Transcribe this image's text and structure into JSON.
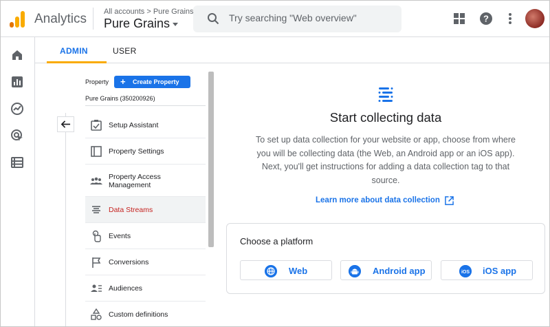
{
  "header": {
    "app_name": "Analytics",
    "breadcrumb": "All accounts > Pure Grains",
    "account_name": "Pure Grains",
    "search_placeholder": "Try searching \"Web overview\""
  },
  "tabs": {
    "admin": "ADMIN",
    "user": "USER"
  },
  "property": {
    "label": "Property",
    "create_button": "Create Property",
    "name": "Pure Grains (350200926)",
    "menu": [
      {
        "label": "Setup Assistant",
        "icon": "checklist-icon"
      },
      {
        "label": "Property Settings",
        "icon": "settings-panel-icon"
      },
      {
        "label": "Property Access Management",
        "icon": "people-icon"
      },
      {
        "label": "Data Streams",
        "icon": "streams-icon",
        "active": true
      },
      {
        "label": "Events",
        "icon": "touch-icon"
      },
      {
        "label": "Conversions",
        "icon": "flag-icon"
      },
      {
        "label": "Audiences",
        "icon": "audience-icon"
      },
      {
        "label": "Custom definitions",
        "icon": "shapes-icon"
      }
    ]
  },
  "content": {
    "title": "Start collecting data",
    "description": "To set up data collection for your website or app, choose from where you will be collecting data (the Web, an Android app or an iOS app). Next, you'll get instructions for adding a data collection tag to that source.",
    "learn_more": "Learn more about data collection",
    "platform_title": "Choose a platform",
    "platforms": [
      {
        "label": "Web",
        "icon": "globe-icon"
      },
      {
        "label": "Android app",
        "icon": "android-icon"
      },
      {
        "label": "iOS app",
        "icon": "ios-icon"
      }
    ]
  },
  "colors": {
    "accent": "#1a73e8",
    "active_text": "#c5221f",
    "tab_indicator": "#f9ab00"
  }
}
